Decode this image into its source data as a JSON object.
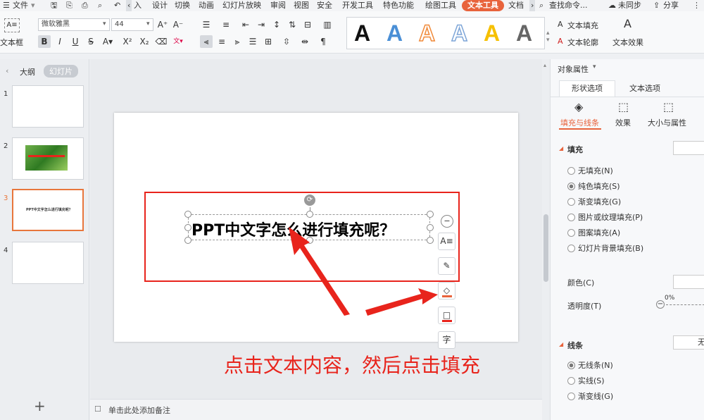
{
  "menubar": {
    "file": "文件",
    "items": [
      "入",
      "设计",
      "切换",
      "动画",
      "幻灯片放映",
      "审阅",
      "视图",
      "安全",
      "开发工具",
      "特色功能",
      "绘图工具",
      "文本工具",
      "文档"
    ],
    "search": "查找命令...",
    "sync": "未同步",
    "share": "分享"
  },
  "ribbon": {
    "textbox_label": "文本框",
    "font_name": "微软雅黑",
    "font_size": "44",
    "fill_label": "文本填充",
    "outline_label": "文本轮廓",
    "effect_label": "文本效果",
    "gallery_glyph": "A",
    "gallery_colors": [
      "#111111",
      "#4a8fd6",
      "#f08a3a",
      "#7ea6d8",
      "#f6c000",
      "#666666"
    ]
  },
  "left_pane": {
    "tab_outline": "大纲",
    "tab_slides": "幻灯片",
    "slide_numbers": [
      "1",
      "2",
      "3",
      "4"
    ],
    "slide3_text": "PPT中文字怎么进行填充呢？",
    "add": "+"
  },
  "slide": {
    "text": "PPT中文字怎么进行填充呢？",
    "side_char": "字"
  },
  "notes": {
    "placeholder": "单击此处添加备注"
  },
  "annotation": "点击文本内容，然后点击填充",
  "right_pane": {
    "header": "对象属性",
    "tab_shape": "形状选项",
    "tab_text": "文本选项",
    "sub_fill_line": "填充与线条",
    "sub_effect": "效果",
    "sub_size": "大小与属性",
    "section_fill": "填充",
    "fill_options": [
      "无填充(N)",
      "纯色填充(S)",
      "渐变填充(G)",
      "图片或纹理填充(P)",
      "图案填充(A)",
      "幻灯片背景填充(B)"
    ],
    "selected_fill": "纯色填充(S)",
    "color_label": "颜色(C)",
    "transparency_label": "透明度(T)",
    "transparency_value": "0%",
    "section_line": "线条",
    "line_value": "无",
    "line_options": [
      "无线条(N)",
      "实线(S)",
      "渐变线(G)"
    ]
  },
  "colors": {
    "accent": "#e8633c",
    "annotation": "#e8241c",
    "selection_box": "#e8241c"
  }
}
